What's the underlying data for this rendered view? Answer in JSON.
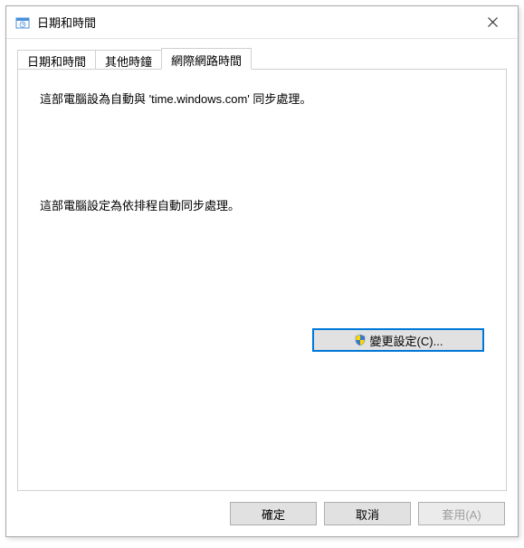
{
  "window": {
    "title": "日期和時間"
  },
  "tabs": {
    "datetime": "日期和時間",
    "other_clocks": "其他時鐘",
    "internet_time": "網際網路時間"
  },
  "content": {
    "sync_info": "這部電腦設為自動與 'time.windows.com' 同步處理。",
    "schedule_info": "這部電腦設定為依排程自動同步處理。",
    "change_settings": "變更設定(C)..."
  },
  "buttons": {
    "ok": "確定",
    "cancel": "取消",
    "apply": "套用(A)"
  }
}
